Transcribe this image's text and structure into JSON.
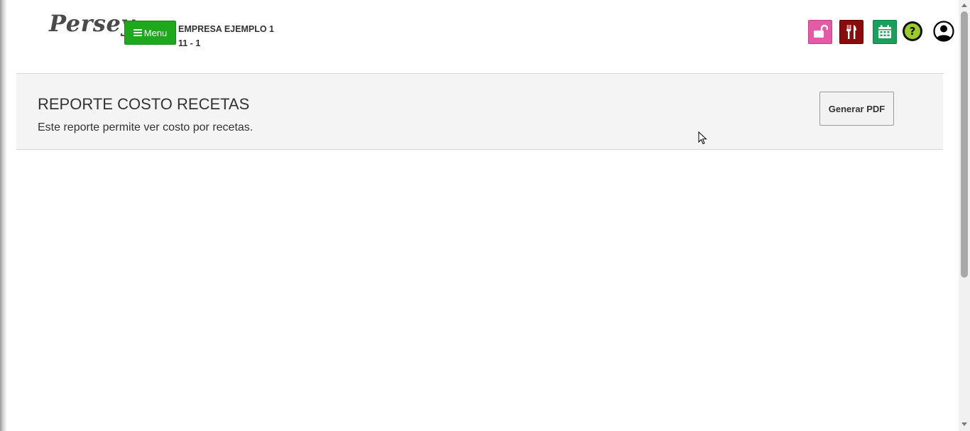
{
  "header": {
    "logo_text": "Persey",
    "menu_label": "Menu",
    "company_name": "EMPRESA EJEMPLO 1",
    "company_code": "11 - 1",
    "icons": [
      {
        "name": "lock-open-icon",
        "color": "#e55aa6"
      },
      {
        "name": "fork-knife-icon",
        "color": "#8b0a0a"
      },
      {
        "name": "calendar-icon",
        "color": "#19a05a"
      },
      {
        "name": "help-icon",
        "color": "#9ccc2a"
      },
      {
        "name": "user-account-icon",
        "color": "#000000"
      }
    ],
    "menu_color": "#1ea81b"
  },
  "report": {
    "title": "REPORTE COSTO RECETAS",
    "description": "Este reporte permite ver costo por recetas.",
    "pdf_button_label": "Generar PDF"
  }
}
